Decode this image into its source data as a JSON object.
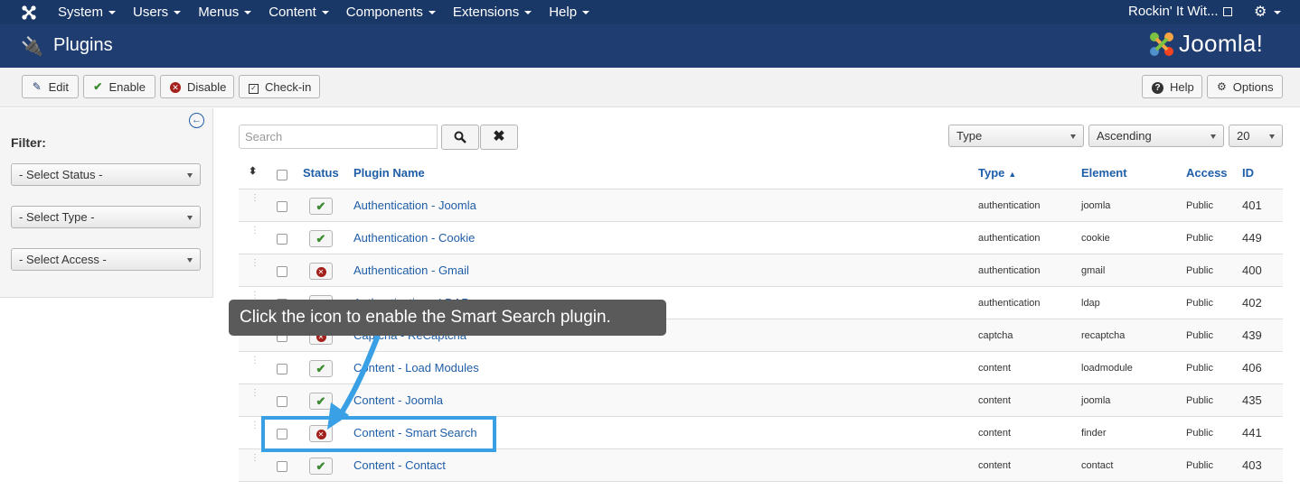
{
  "topnav": {
    "menu": [
      "System",
      "Users",
      "Menus",
      "Content",
      "Components",
      "Extensions",
      "Help"
    ],
    "site_name": "Rockin' It Wit..."
  },
  "header": {
    "title": "Plugins",
    "brand": "Joomla!"
  },
  "toolbar": {
    "edit": "Edit",
    "enable": "Enable",
    "disable": "Disable",
    "checkin": "Check-in",
    "help": "Help",
    "options": "Options"
  },
  "sidebar": {
    "filter_title": "Filter:",
    "status": "- Select Status -",
    "type": "- Select Type -",
    "access": "- Select Access -"
  },
  "search": {
    "placeholder": "Search"
  },
  "list_controls": {
    "order_by": "Type",
    "direction": "Ascending",
    "limit": "20"
  },
  "table": {
    "headers": {
      "status": "Status",
      "name": "Plugin Name",
      "type": "Type",
      "element": "Element",
      "access": "Access",
      "id": "ID"
    },
    "rows": [
      {
        "enabled": true,
        "name": "Authentication - Joomla",
        "type": "authentication",
        "element": "joomla",
        "access": "Public",
        "id": "401"
      },
      {
        "enabled": true,
        "name": "Authentication - Cookie",
        "type": "authentication",
        "element": "cookie",
        "access": "Public",
        "id": "449"
      },
      {
        "enabled": false,
        "name": "Authentication - Gmail",
        "type": "authentication",
        "element": "gmail",
        "access": "Public",
        "id": "400"
      },
      {
        "enabled": false,
        "name": "Authentication - LDAP",
        "type": "authentication",
        "element": "ldap",
        "access": "Public",
        "id": "402"
      },
      {
        "enabled": false,
        "name": "Captcha - ReCaptcha",
        "type": "captcha",
        "element": "recaptcha",
        "access": "Public",
        "id": "439"
      },
      {
        "enabled": true,
        "name": "Content - Load Modules",
        "type": "content",
        "element": "loadmodule",
        "access": "Public",
        "id": "406"
      },
      {
        "enabled": true,
        "name": "Content - Joomla",
        "type": "content",
        "element": "joomla",
        "access": "Public",
        "id": "435"
      },
      {
        "enabled": false,
        "name": "Content - Smart Search",
        "type": "content",
        "element": "finder",
        "access": "Public",
        "id": "441"
      },
      {
        "enabled": true,
        "name": "Content - Contact",
        "type": "content",
        "element": "contact",
        "access": "Public",
        "id": "403"
      }
    ]
  },
  "annotation": {
    "text": "Click the icon to enable the Smart Search plugin.",
    "color": "#3aa0e5"
  }
}
